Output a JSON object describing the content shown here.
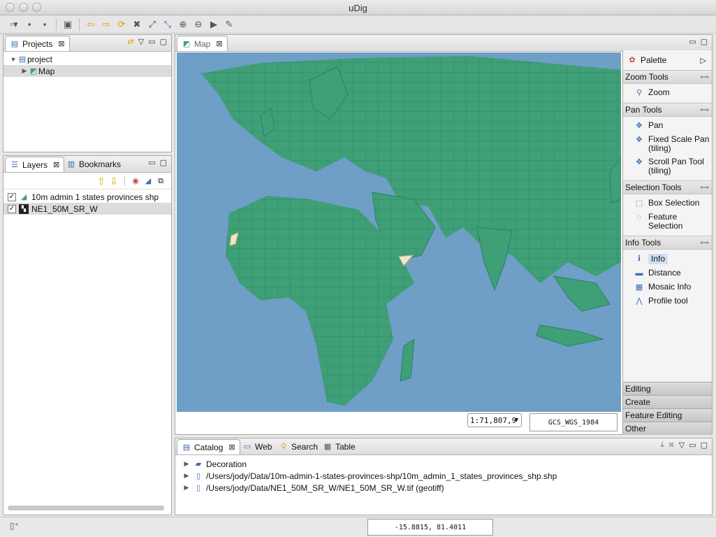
{
  "window": {
    "title": "uDig"
  },
  "projects_panel": {
    "tab_label": "Projects",
    "tree": [
      {
        "label": "project",
        "expanded": true
      },
      {
        "label": "Map",
        "selected": true
      }
    ]
  },
  "layers_panel": {
    "tabs": [
      "Layers",
      "Bookmarks"
    ],
    "layers": [
      {
        "name": "10m admin 1 states provinces shp",
        "checked": true
      },
      {
        "name": "NE1_50M_SR_W",
        "checked": true
      }
    ]
  },
  "map_panel": {
    "tab_label": "Map",
    "scale": "1:71,807,9",
    "crs": "GCS_WGS_1984"
  },
  "palette": {
    "title": "Palette",
    "groups": [
      {
        "title": "Zoom Tools",
        "items": [
          {
            "label": "Zoom",
            "icon": "magnifier-icon"
          }
        ]
      },
      {
        "title": "Pan Tools",
        "items": [
          {
            "label": "Pan",
            "icon": "pan-arrows-icon"
          },
          {
            "label": "Fixed Scale Pan",
            "sub": "(tiling)",
            "icon": "pan-arrows-icon"
          },
          {
            "label": "Scroll Pan Tool",
            "sub": "(tiling)",
            "icon": "pan-arrows-icon"
          }
        ]
      },
      {
        "title": "Selection Tools",
        "items": [
          {
            "label": "Box Selection",
            "icon": "box-select-icon"
          },
          {
            "label": "Feature",
            "sub": "Selection",
            "icon": "lasso-icon"
          }
        ]
      },
      {
        "title": "Info Tools",
        "items": [
          {
            "label": "Info",
            "icon": "info-icon",
            "selected": true
          },
          {
            "label": "Distance",
            "icon": "ruler-icon"
          },
          {
            "label": "Mosaic Info",
            "icon": "mosaic-info-icon"
          },
          {
            "label": "Profile tool",
            "icon": "profile-icon"
          }
        ]
      }
    ],
    "drawers": [
      "Editing",
      "Create",
      "Feature Editing",
      "Other"
    ]
  },
  "catalog_panel": {
    "tabs": [
      "Catalog",
      "Web",
      "Search",
      "Table"
    ],
    "items": [
      {
        "label": "Decoration"
      },
      {
        "label": "/Users/jody/Data/10m-admin-1-states-provinces-shp/10m_admin_1_states_provinces_shp.shp"
      },
      {
        "label": "/Users/jody/Data/NE1_50M_SR_W/NE1_50M_SR_W.tif (geotiff)"
      }
    ]
  },
  "status": {
    "coordinates": "-15.8815, 81.4011"
  },
  "colors": {
    "ocean": "#6f9ec6",
    "land": "#3f9f77",
    "selection": "#cfe0f5"
  }
}
